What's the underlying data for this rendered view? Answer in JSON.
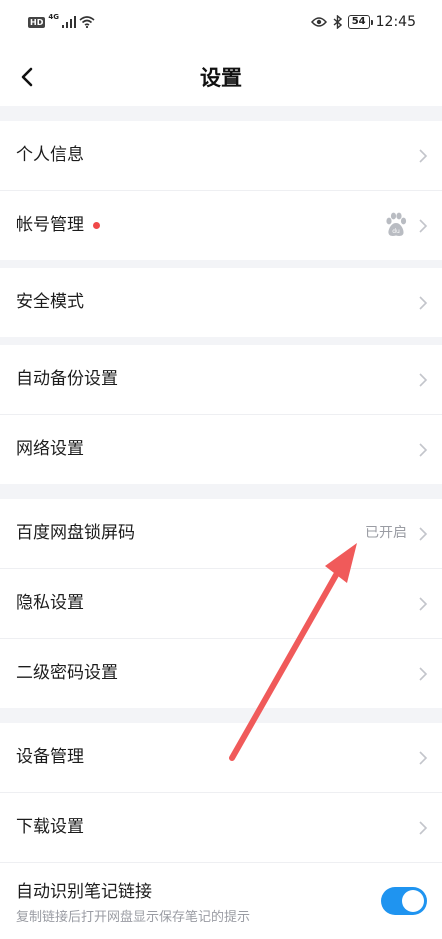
{
  "status_bar": {
    "hd_badge": "HD",
    "network": "4G",
    "battery": "54",
    "time": "12:45"
  },
  "header": {
    "title": "设置"
  },
  "groups": [
    {
      "items": [
        {
          "label": "个人信息"
        },
        {
          "label": "帐号管理"
        }
      ]
    },
    {
      "items": [
        {
          "label": "安全模式"
        }
      ]
    },
    {
      "items": [
        {
          "label": "自动备份设置"
        },
        {
          "label": "网络设置"
        }
      ]
    },
    {
      "items": [
        {
          "label": "百度网盘锁屏码",
          "value": "已开启"
        },
        {
          "label": "隐私设置"
        },
        {
          "label": "二级密码设置"
        }
      ]
    },
    {
      "items": [
        {
          "label": "设备管理"
        },
        {
          "label": "下载设置"
        },
        {
          "label": "自动识别笔记链接",
          "description": "复制链接后打开网盘显示保存笔记的提示",
          "toggle_on": true
        }
      ]
    }
  ],
  "icons": {
    "back": "back-arrow-icon",
    "chevron": "chevron-right-icon",
    "baidu": "baidu-paw-icon"
  },
  "colors": {
    "accent": "#1f94f0",
    "badge_dot": "#f04848",
    "annotation_arrow": "#f05a5a"
  }
}
